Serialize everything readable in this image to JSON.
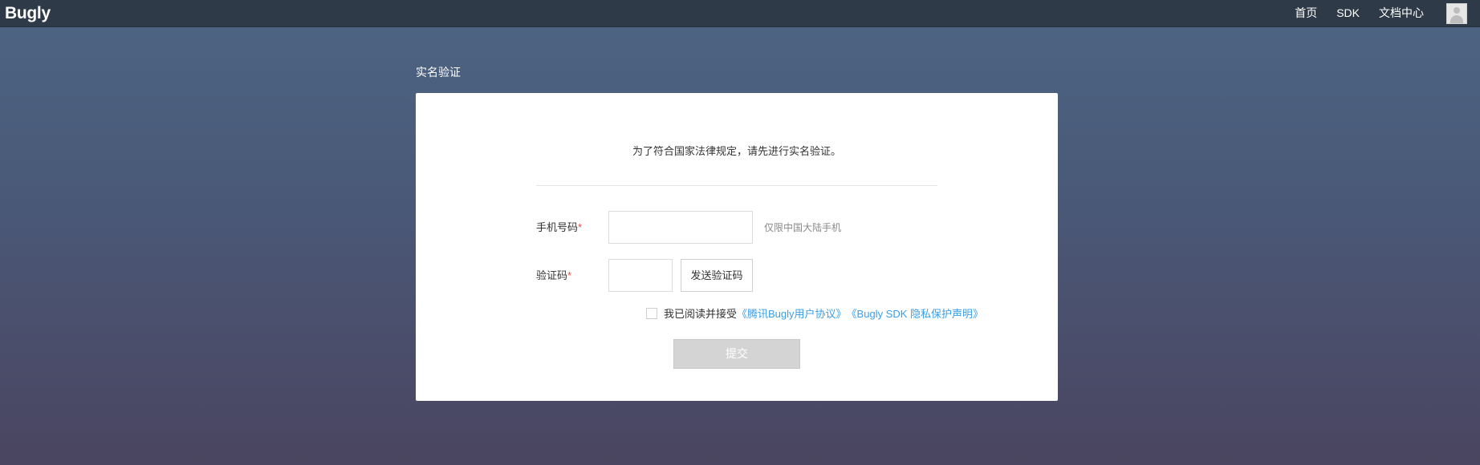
{
  "header": {
    "logo": "Bugly",
    "nav": [
      "首页",
      "SDK",
      "文档中心"
    ]
  },
  "page": {
    "title": "实名验证"
  },
  "form": {
    "notice": "为了符合国家法律规定，请先进行实名验证。",
    "phone_label": "手机号码",
    "phone_value": "",
    "phone_hint": "仅限中国大陆手机",
    "code_label": "验证码",
    "code_value": "",
    "required_mark": "*",
    "send_code": "发送验证码",
    "agree_prefix": "我已阅读并接受",
    "agree_link_1": "《腾讯Bugly用户协议》",
    "agree_link_2": "《Bugly SDK 隐私保护声明》",
    "agree_checked": false,
    "submit": "提交"
  },
  "colors": {
    "topbar": "#2e3a47",
    "required": "#e84a4a",
    "link": "#3b9ee6",
    "submit_disabled": "#d4d4d4"
  }
}
